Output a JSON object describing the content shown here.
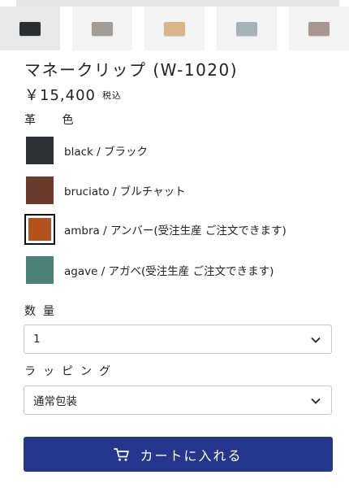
{
  "thumbnails": [
    {
      "name": "thumb-black",
      "color": "#2b2d2f",
      "selected": true
    },
    {
      "name": "thumb-grey",
      "color": "#a39c96",
      "selected": false
    },
    {
      "name": "thumb-tan",
      "color": "#d8b48a",
      "selected": false
    },
    {
      "name": "thumb-bluegrey",
      "color": "#a7b2b6",
      "selected": false
    },
    {
      "name": "thumb-taupe",
      "color": "#a79790",
      "selected": false
    }
  ],
  "product": {
    "title": "マネークリップ (W-1020)",
    "price": "￥15,400",
    "tax_label": "税込"
  },
  "leather_color": {
    "label": "革 色",
    "options": [
      {
        "label": "black / ブラック",
        "color": "#2e3235",
        "selected": false
      },
      {
        "label": "bruciato / ブルチャット",
        "color": "#6a3a2c",
        "selected": false
      },
      {
        "label": "ambra / アンバー(受注生産 ご注文できます)",
        "color": "#b5531f",
        "selected": true
      },
      {
        "label": "agave / アガベ(受注生産 ご注文できます)",
        "color": "#4a8275",
        "selected": false
      }
    ]
  },
  "quantity": {
    "label": "数量",
    "value": "1"
  },
  "wrapping": {
    "label": "ラッピング",
    "value": "通常包装"
  },
  "cart_button": {
    "label": "カートに入れる"
  },
  "colors": {
    "accent": "#24378c",
    "border": "#c8c8c8"
  }
}
